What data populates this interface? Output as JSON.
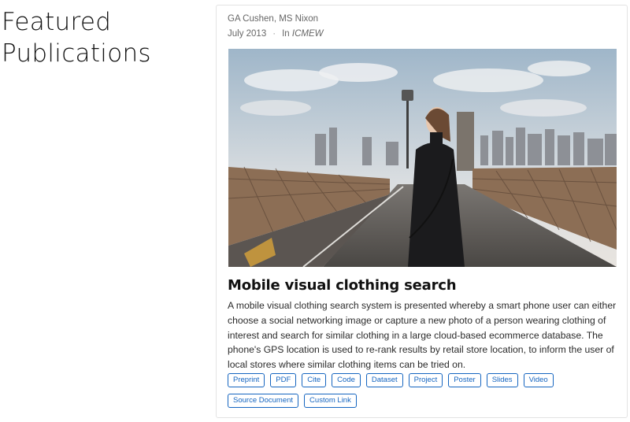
{
  "section": {
    "title_line1": "Featured",
    "title_line2": "Publications"
  },
  "publication": {
    "authors": "GA Cushen, MS Nixon",
    "date": "July 2013",
    "separator": "·",
    "venue_prefix": "In",
    "venue": "ICMEW",
    "title": "Mobile visual clothing search",
    "abstract": "A mobile visual clothing search system is presented whereby a smart phone user can either choose a social networking image or capture a new photo of a person wearing clothing of interest and search for similar clothing in a large cloud-based ecommerce database. The phone's GPS location is used to re-rank results by retail store location, to inform the user of local stores where similar clothing items can be tried on.",
    "image_alt": "Woman in black coat standing on a bridge with a city skyline behind her",
    "buttons": [
      "Preprint",
      "PDF",
      "Cite",
      "Code",
      "Dataset",
      "Project",
      "Poster",
      "Slides",
      "Video",
      "Source Document",
      "Custom Link"
    ]
  },
  "colors": {
    "link": "#1565c0",
    "border": "#e3e3e3"
  }
}
